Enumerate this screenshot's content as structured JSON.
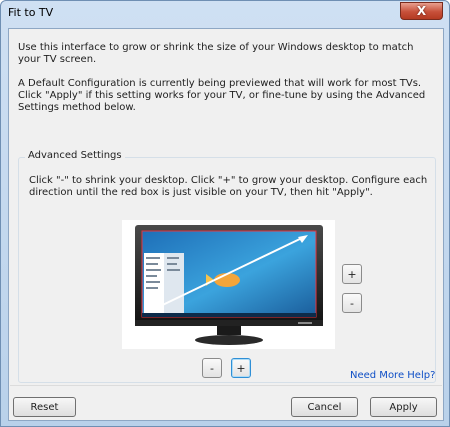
{
  "window": {
    "title": "Fit to TV",
    "close_glyph": "X"
  },
  "intro": {
    "paragraph1": "Use this interface to grow or shrink the size of your Windows desktop to match your TV screen.",
    "paragraph2": "A Default Configuration is currently being previewed that will work for most TVs. Click \"Apply\" if this setting works for your TV, or fine-tune by using the Advanced Settings method below."
  },
  "advanced": {
    "group_label": "Advanced Settings",
    "description": "Click \"-\" to shrink  your desktop. Click \"+\" to grow your desktop. Configure each direction until the red box is just visible on your TV, then hit \"Apply\".",
    "vertical_plus": "+",
    "vertical_minus": "-",
    "horizontal_minus": "-",
    "horizontal_plus": "+",
    "monitor_icon": "tv-monitor-preview-icon"
  },
  "help_link": "Need More Help?",
  "buttons": {
    "reset": "Reset",
    "cancel": "Cancel",
    "apply": "Apply"
  },
  "colors": {
    "link": "#0f4fc6",
    "close_button": "#c7503a",
    "focus_border": "#2f8fd6"
  }
}
